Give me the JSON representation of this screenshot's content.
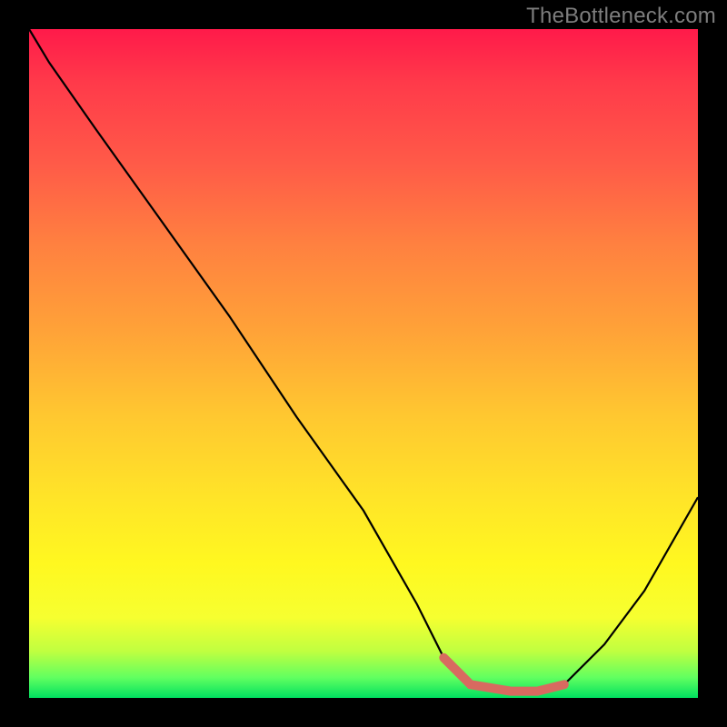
{
  "attribution": "TheBottleneck.com",
  "colors": {
    "highlight": "#d86a60",
    "curve": "#000000"
  },
  "chart_data": {
    "type": "line",
    "title": "",
    "xlabel": "",
    "ylabel": "",
    "xlim": [
      0,
      100
    ],
    "ylim": [
      0,
      100
    ],
    "grid": false,
    "series": [
      {
        "name": "bottleneck-curve",
        "x": [
          0,
          3,
          10,
          20,
          30,
          40,
          50,
          58,
          62,
          66,
          72,
          76,
          80,
          86,
          92,
          100
        ],
        "y": [
          100,
          95,
          85,
          71,
          57,
          42,
          28,
          14,
          6,
          2,
          1,
          1,
          2,
          8,
          16,
          30
        ]
      }
    ],
    "highlight_region": {
      "name": "minimum-band",
      "x": [
        62,
        66,
        72,
        76,
        80
      ],
      "y": [
        6,
        2,
        1,
        1,
        2
      ]
    }
  }
}
